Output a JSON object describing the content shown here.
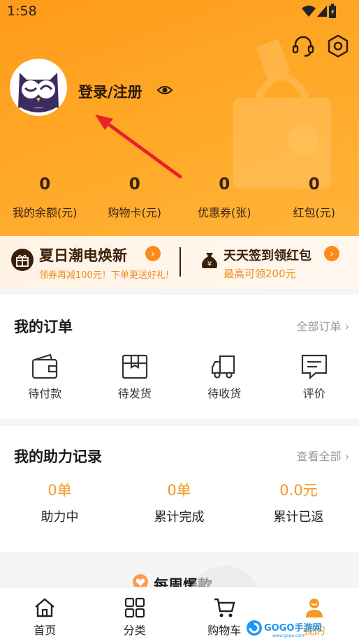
{
  "status_bar": {
    "time": "1:58"
  },
  "header": {
    "login_text": "登录/注册",
    "stats": [
      {
        "value": "0",
        "label": "我的余额(元)"
      },
      {
        "value": "0",
        "label": "购物卡(元)"
      },
      {
        "value": "0",
        "label": "优惠券(张)"
      },
      {
        "value": "0",
        "label": "红包(元)"
      }
    ]
  },
  "promo": {
    "left": {
      "title": "夏日潮电焕新",
      "subtitle": "领券再减100元！下单更送好礼!"
    },
    "right": {
      "title": "天天签到领红包",
      "subtitle": "最高可领200元"
    }
  },
  "orders": {
    "title": "我的订单",
    "more": "全部订单",
    "items": [
      {
        "label": "待付款",
        "icon": "wallet-icon"
      },
      {
        "label": "待发货",
        "icon": "package-icon"
      },
      {
        "label": "待收货",
        "icon": "truck-icon"
      },
      {
        "label": "评价",
        "icon": "comment-icon"
      }
    ]
  },
  "assist": {
    "title": "我的助力记录",
    "more": "查看全部",
    "items": [
      {
        "value": "0单",
        "label": "助力中"
      },
      {
        "value": "0单",
        "label": "累计完成"
      },
      {
        "value": "0.0元",
        "label": "累计已返"
      }
    ]
  },
  "weekly": {
    "title": "每周爆款"
  },
  "nav": {
    "items": [
      {
        "label": "首页",
        "icon": "home-icon"
      },
      {
        "label": "分类",
        "icon": "category-icon"
      },
      {
        "label": "购物车",
        "icon": "cart-icon"
      },
      {
        "label": "我的",
        "icon": "profile-icon"
      }
    ]
  },
  "watermark": {
    "text": "GOGO手游网",
    "sub": "www.gogo.com"
  },
  "colors": {
    "accent": "#ff9a1a",
    "orange_text": "#f39a23",
    "arrow": "#e8222a"
  }
}
